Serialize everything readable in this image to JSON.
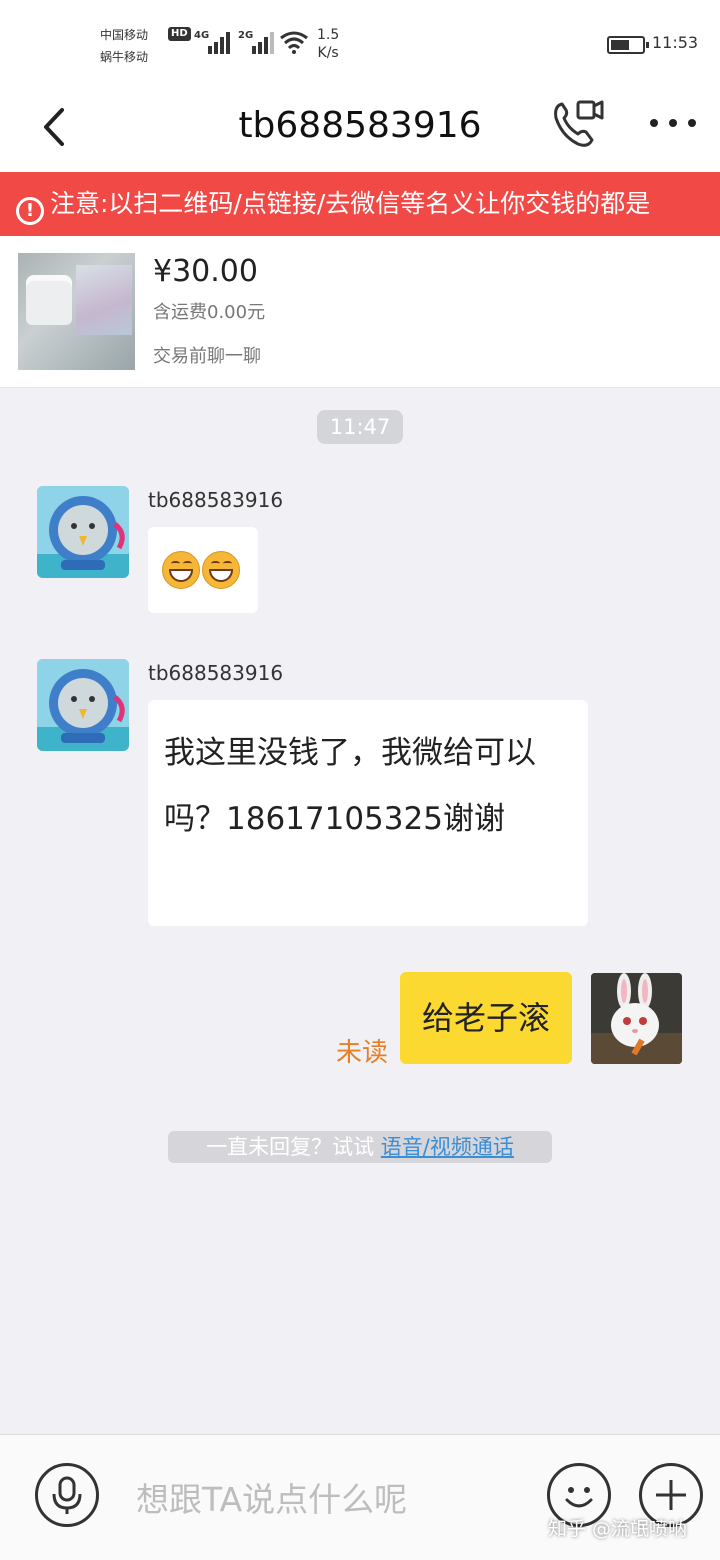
{
  "status_bar": {
    "carrier1": "中国移动",
    "carrier2": "蜗牛移动",
    "hd": "HD",
    "net1": "4G",
    "net2": "2G",
    "speed_value": "1.5",
    "speed_unit": "K/s",
    "battery_level": 0.6,
    "time": "11:53"
  },
  "header": {
    "title": "tb688583916"
  },
  "warning": {
    "text": "注意:以扫二维码/点链接/去微信等名义让你交钱的都是"
  },
  "product": {
    "price": "¥30.00",
    "shipping": "含运费0.00元",
    "action": "交易前聊一聊"
  },
  "chat": {
    "timestamp": "11:47",
    "messages": [
      {
        "sender": "tb688583916",
        "type": "emoji",
        "emoji": "grinning-face"
      },
      {
        "sender": "tb688583916",
        "type": "text",
        "text": "我这里没钱了，我微给可以吗？18617105325谢谢"
      },
      {
        "sender": "me",
        "type": "text",
        "text": "给老子滚",
        "status": "未读"
      }
    ],
    "hint_text": "一直未回复？试试 ",
    "hint_link": "语音/视频通话"
  },
  "input_bar": {
    "placeholder": "想跟TA说点什么呢"
  },
  "watermark": "知乎 @流氓喷呐",
  "colors": {
    "warning_bg": "#f14a46",
    "my_bubble": "#fcd930",
    "unread": "#e77f27",
    "link": "#3a8ed4"
  }
}
